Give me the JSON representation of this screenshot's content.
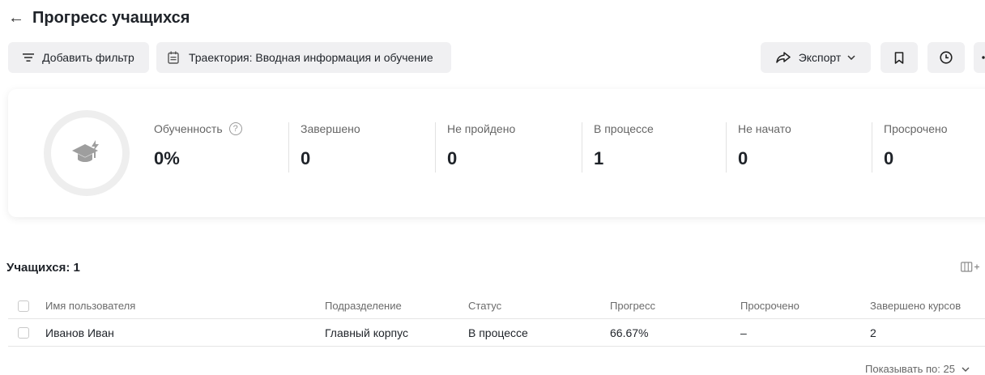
{
  "header": {
    "back_icon": "arrow-left-icon",
    "title": "Прогресс учащихся"
  },
  "toolbar": {
    "add_filter_label": "Добавить фильтр",
    "trajectory_label": "Траектория: Вводная информация и обучение",
    "export_label": "Экспорт",
    "icons": [
      "filter-icon",
      "calendar-icon",
      "share-arrow-icon",
      "chevron-down-icon",
      "bookmark-icon",
      "clock-icon",
      "more-icon"
    ]
  },
  "stats": {
    "training_label": "Обученность",
    "training_value": "0%",
    "items": [
      {
        "label": "Завершено",
        "value": "0"
      },
      {
        "label": "Не пройдено",
        "value": "0"
      },
      {
        "label": "В процессе",
        "value": "1"
      },
      {
        "label": "Не начато",
        "value": "0"
      },
      {
        "label": "Просрочено",
        "value": "0"
      }
    ]
  },
  "learners": {
    "count_label": "Учащихся: 1",
    "columns_icon": "columns-add-icon",
    "headers": [
      "Имя пользователя",
      "Подразделение",
      "Статус",
      "Прогресс",
      "Просрочено",
      "Завершено курсов"
    ],
    "rows": [
      {
        "name": "Иванов Иван",
        "department": "Главный корпус",
        "status": "В процессе",
        "progress": "66.67%",
        "overdue": "–",
        "completed": "2"
      }
    ]
  },
  "pagination": {
    "page_size_label": "Показывать по: 25"
  },
  "colors": {
    "button_bg": "#f0f0f2",
    "text": "#1f2329",
    "muted": "#666666"
  }
}
